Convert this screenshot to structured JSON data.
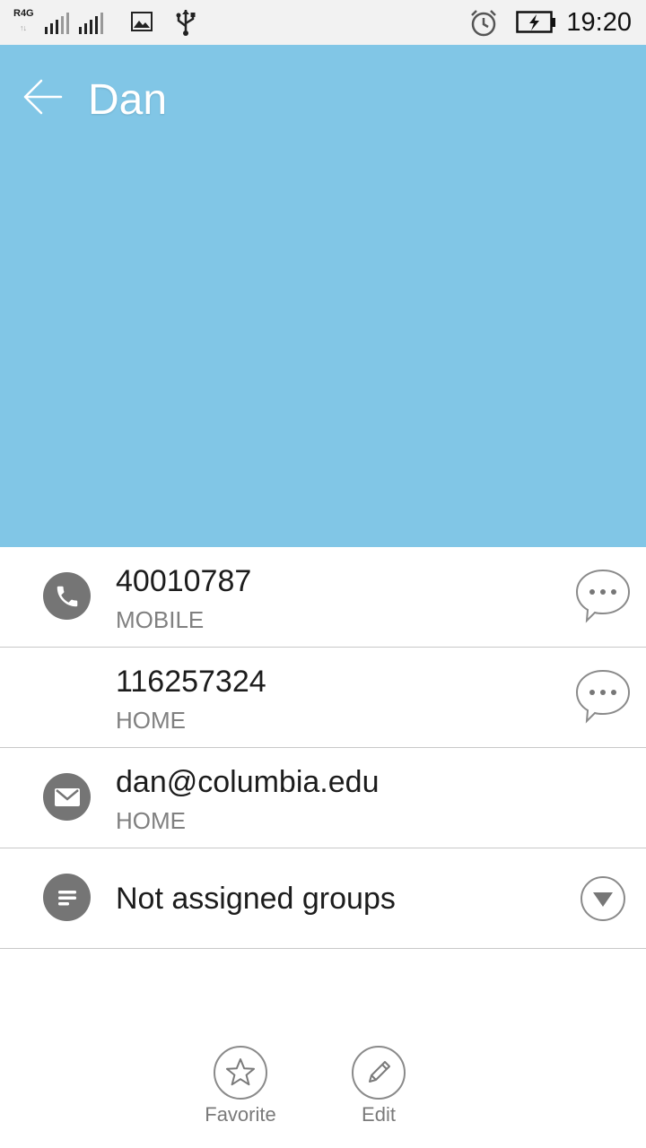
{
  "status_bar": {
    "network_label": "R4G",
    "time": "19:20",
    "icons": [
      "data-arrows-icon",
      "signal-icon",
      "gallery-icon",
      "usb-icon",
      "alarm-icon",
      "battery-charging-icon"
    ]
  },
  "header": {
    "contact_name": "Dan",
    "background_color": "#81c6e6",
    "back_icon": "back-arrow-icon"
  },
  "details": {
    "phone_mobile": {
      "number": "40010787",
      "type": "MOBILE",
      "icon": "phone-icon",
      "action_icon": "message-bubble-icon"
    },
    "phone_home": {
      "number": "116257324",
      "type": "HOME",
      "action_icon": "message-bubble-icon"
    },
    "email": {
      "address": "dan@columbia.edu",
      "type": "HOME",
      "icon": "email-icon"
    },
    "groups": {
      "label": "Not assigned groups",
      "icon": "groups-icon",
      "action_icon": "dropdown-triangle-icon"
    }
  },
  "actions": {
    "favorite": {
      "label": "Favorite",
      "icon": "star-icon"
    },
    "edit": {
      "label": "Edit",
      "icon": "pencil-icon"
    }
  }
}
